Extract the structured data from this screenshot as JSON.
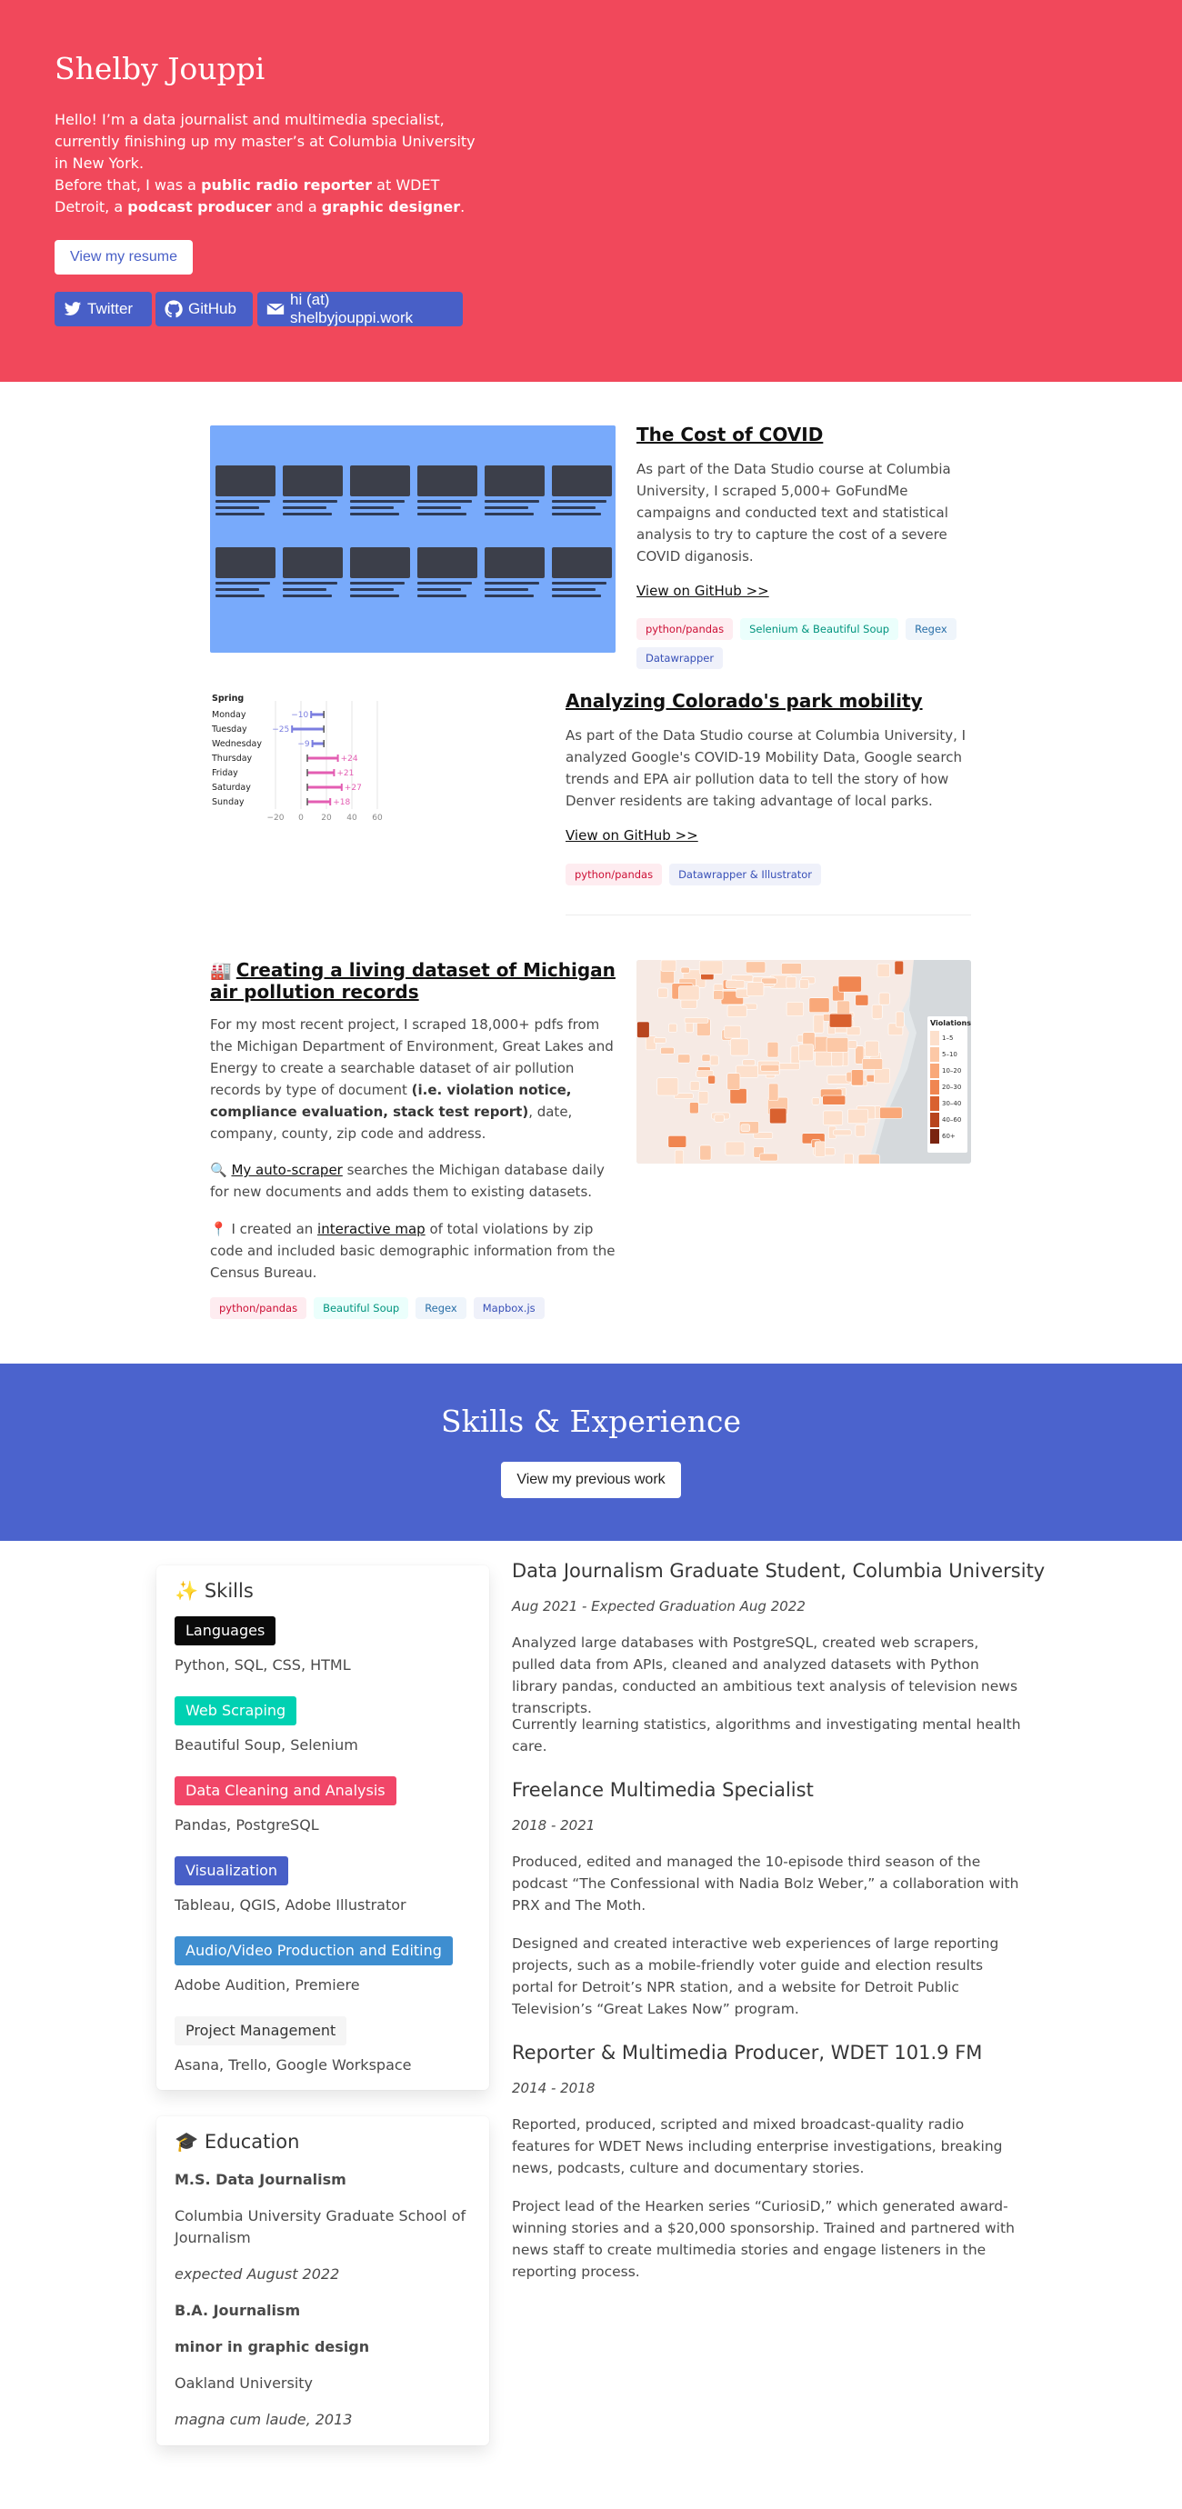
{
  "hero": {
    "name": "Shelby Jouppi",
    "intro_line1": "Hello! I’m a data journalist and multimedia specialist, currently finishing up my master’s at Columbia University in New York.",
    "intro_before": "Before that, I was a ",
    "role1": "public radio reporter",
    "intro_mid1": " at WDET Detroit, a ",
    "role2": "podcast producer",
    "intro_mid2": " and a ",
    "role3": "graphic designer",
    "intro_end": ".",
    "resume_label": "View my resume",
    "twitter_label": "Twitter",
    "github_label": "GitHub",
    "email_label": "hi (at) shelbyjouppi.work",
    "color": "#f1485b",
    "button_color": "#485fc7"
  },
  "projects": {
    "covid": {
      "title": "The Cost of COVID",
      "desc": "As part of the Data Studio course at Columbia University, I scraped 5,000+ GoFundMe campaigns and conducted text and statistical analysis to try to capture the cost of a severe COVID diganosis.",
      "link": "View on GitHub >>",
      "tags": [
        "python/pandas",
        "Selenium & Beautiful Soup",
        "Regex",
        "Datawrapper"
      ]
    },
    "colorado": {
      "title": "Analyzing Colorado's park mobility",
      "desc": "As part of the Data Studio course at Columbia University, I analyzed Google's COVID-19 Mobility Data, Google search trends and EPA air pollution data to tell the story of how Denver residents are taking advantage of local parks.",
      "link": "View on GitHub >>",
      "tags": [
        "python/pandas",
        "Datawrapper & Illustrator"
      ],
      "chart": {
        "heading": "Spring",
        "days": [
          "Monday",
          "Tuesday",
          "Wednesday",
          "Thursday",
          "Friday",
          "Saturday",
          "Sunday"
        ],
        "values": [
          "−10",
          "−25",
          "−9",
          "+24",
          "+21",
          "+27",
          "+18"
        ],
        "ticks": [
          "−20",
          "0",
          "20",
          "40",
          "60"
        ]
      }
    },
    "michigan": {
      "emoji": "🏭",
      "title": "Creating a living dataset of Michigan air pollution records",
      "desc_before": "For my most recent project, I scraped 18,000+ pdfs from the Michigan Department of Environment, Great Lakes and Energy to create a searchable dataset of air pollution records by type of document ",
      "desc_bold": "(i.e. violation notice, compliance evaluation, stack test report)",
      "desc_after": ", date, company, county, zip code and address.",
      "scraper_emoji": "🔍",
      "scraper_link": "My auto-scraper",
      "scraper_text": " searches the Michigan database daily for new documents and adds them to existing datasets.",
      "map_emoji": "📍",
      "map_before": "I created an ",
      "map_link": "interactive map",
      "map_after": " of total violations by zip code and included basic demographic information from the Census Bureau.",
      "tags": [
        "python/pandas",
        "Beautiful Soup",
        "Regex",
        "Mapbox.js"
      ],
      "legend_title": "Violations",
      "legend": [
        "1–5",
        "5–10",
        "10–20",
        "20–30",
        "30–40",
        "40–60",
        "60+"
      ]
    }
  },
  "skills_band": {
    "title": "Skills & Experience",
    "button": "View my previous work",
    "color": "#4b63cd"
  },
  "skills": {
    "emoji": "✨",
    "heading": "Skills",
    "items": [
      {
        "tag": "Languages",
        "list": "Python, SQL, CSS, HTML",
        "bg": "#0a0a0a",
        "fg": "#ffffff"
      },
      {
        "tag": "Web Scraping",
        "list": "Beautiful Soup, Selenium",
        "bg": "#00d1b2",
        "fg": "#ffffff"
      },
      {
        "tag": "Data Cleaning and Analysis",
        "list": "Pandas, PostgreSQL",
        "bg": "#f14668",
        "fg": "#ffffff"
      },
      {
        "tag": "Visualization",
        "list": "Tableau, QGIS, Adobe Illustrator",
        "bg": "#485fc7",
        "fg": "#ffffff"
      },
      {
        "tag": "Audio/Video Production and Editing",
        "list": "Adobe Audition, Premiere",
        "bg": "#3e8ed0",
        "fg": "#ffffff"
      },
      {
        "tag": "Project Management",
        "list": "Asana, Trello, Google Workspace",
        "bg": "#f5f5f5",
        "fg": "#363636"
      }
    ]
  },
  "education": {
    "emoji": "🎓",
    "heading": "Education",
    "degree1": "M.S. Data Journalism",
    "school1": "Columbia University Graduate School of Journalism",
    "date1": "expected August 2022",
    "degree2": "B.A. Journalism",
    "minor2": "minor in graphic design",
    "school2": "Oakland University",
    "date2": "magna cum laude, 2013"
  },
  "experience": [
    {
      "title": "Data Journalism Graduate Student, Columbia University",
      "date": "Aug 2021 - Expected Graduation Aug 2022",
      "p1": "Analyzed large databases with PostgreSQL, created web scrapers, pulled data from APIs, cleaned and analyzed datasets with Python library pandas, conducted an ambitious text analysis of television news transcripts.",
      "p2": "Currently learning statistics, algorithms and investigating mental health care."
    },
    {
      "title": "Freelance Multimedia Specialist",
      "date": "2018 - 2021",
      "p1": "Produced, edited and managed the 10-episode third season of the podcast “The Confessional with Nadia Bolz Weber,” a collaboration with PRX and The Moth.",
      "p2": "Designed and created interactive web experiences of large reporting projects, such as a mobile-friendly voter guide and election results portal for Detroit’s NPR station, and a website for Detroit Public Television’s “Great Lakes Now” program."
    },
    {
      "title": "Reporter & Multimedia Producer, WDET 101.9 FM",
      "date": "2014 - 2018",
      "p1": "Reported, produced, scripted and mixed broadcast-quality radio features for WDET News including enterprise investigations, breaking news, podcasts, culture and documentary stories.",
      "p2": "Project lead of the Hearken series “CuriosiD,” which generated award-winning stories and a $20,000 sponsorship. Trained and partnered with news staff to create multimedia stories and engage listeners in the reporting process."
    }
  ]
}
